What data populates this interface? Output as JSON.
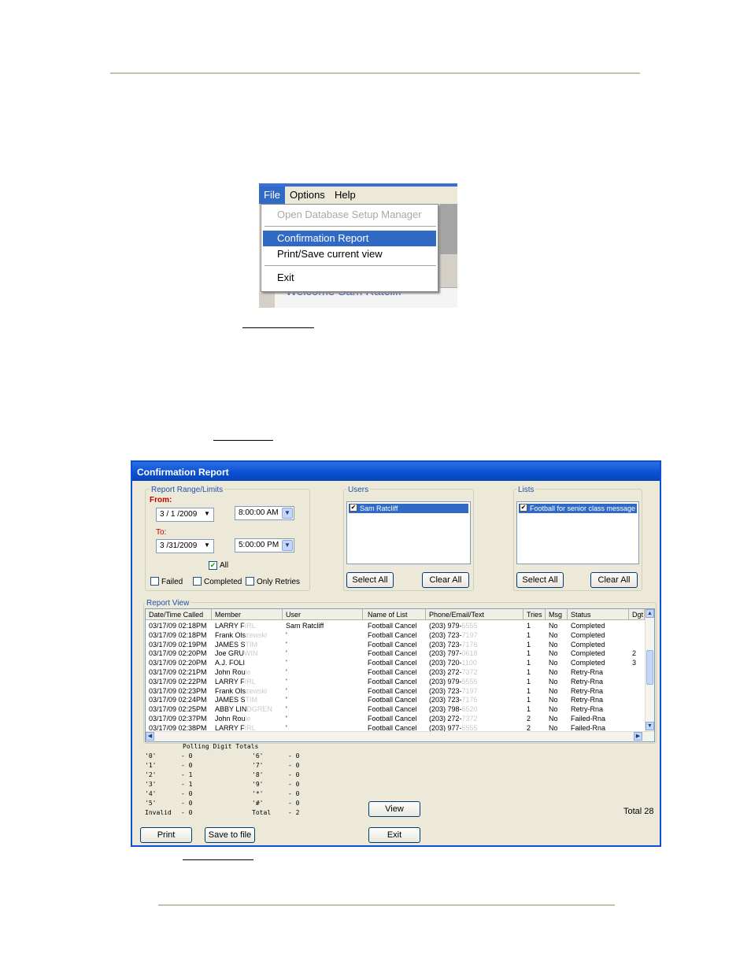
{
  "menu": {
    "bar": [
      "File",
      "Options",
      "Help"
    ],
    "items": {
      "open_db": "Open Database Setup Manager",
      "confirmation_report": "Confirmation Report",
      "print_save": "Print/Save current view",
      "exit": "Exit"
    },
    "welcome": "Welcome Sam Ratcliff"
  },
  "report": {
    "title": "Confirmation Report",
    "range_group": "Report Range/Limits",
    "from_label": "From:",
    "from_date": "3 / 1 /2009",
    "from_time": "8:00:00 AM",
    "to_label": "To:",
    "to_date": "3 /31/2009",
    "to_time": "5:00:00 PM",
    "all_label": "All",
    "failed_label": "Failed",
    "completed_label": "Completed",
    "only_retries_label": "Only Retries",
    "users_group": "Users",
    "user_item": "Sam Ratcliff",
    "lists_group": "Lists",
    "list_item": "Football for senior class message",
    "select_all": "Select All",
    "clear_all": "Clear All",
    "report_view_label": "Report View",
    "columns": [
      "Date/Time Called",
      "Member",
      "User",
      "Name of List",
      "Phone/Email/Text",
      "Tries",
      "Msg",
      "Status",
      "Dgt"
    ],
    "rows": [
      {
        "dt": "03/17/09 02:18PM",
        "m": "LARRY F",
        "mf": "IRL",
        "u": "Sam Ratcliff",
        "l": "Football Cancel",
        "p": "(203) 979-",
        "pf": "5555",
        "t": "1",
        "msg": "No",
        "s": "Completed",
        "d": ""
      },
      {
        "dt": "03/17/09 02:18PM",
        "m": "Frank Ols",
        "mf": "zewski",
        "u": "'",
        "l": "Football Cancel",
        "p": "(203) 723-",
        "pf": "7197",
        "t": "1",
        "msg": "No",
        "s": "Completed",
        "d": ""
      },
      {
        "dt": "03/17/09 02:19PM",
        "m": "JAMES S",
        "mf": "TIM",
        "u": "'",
        "l": "Football Cancel",
        "p": "(203) 723-",
        "pf": "7176",
        "t": "1",
        "msg": "No",
        "s": "Completed",
        "d": ""
      },
      {
        "dt": "03/17/09 02:20PM",
        "m": "Joe GRU",
        "mf": "WIN",
        "u": "'",
        "l": "Football Cancel",
        "p": "(203) 797-",
        "pf": "0618",
        "t": "1",
        "msg": "No",
        "s": "Completed",
        "d": "2"
      },
      {
        "dt": "03/17/09 02:20PM",
        "m": "A.J. FOLI",
        "mf": "",
        "u": "'",
        "l": "Football Cancel",
        "p": "(203) 720-",
        "pf": "1100",
        "t": "1",
        "msg": "No",
        "s": "Completed",
        "d": "3"
      },
      {
        "dt": "03/17/09 02:21PM",
        "m": "John Rou",
        "mf": "le",
        "u": "'",
        "l": "Football Cancel",
        "p": "(203) 272-",
        "pf": "7372",
        "t": "1",
        "msg": "No",
        "s": "Retry-Rna",
        "d": ""
      },
      {
        "dt": "03/17/09 02:22PM",
        "m": "LARRY F",
        "mf": "IRL",
        "u": "'",
        "l": "Football Cancel",
        "p": "(203) 979-",
        "pf": "5555",
        "t": "1",
        "msg": "No",
        "s": "Retry-Rna",
        "d": ""
      },
      {
        "dt": "03/17/09 02:23PM",
        "m": "Frank Ols",
        "mf": "zewski",
        "u": "'",
        "l": "Football Cancel",
        "p": "(203) 723-",
        "pf": "7197",
        "t": "1",
        "msg": "No",
        "s": "Retry-Rna",
        "d": ""
      },
      {
        "dt": "03/17/09 02:24PM",
        "m": "JAMES S",
        "mf": "TIM",
        "u": "'",
        "l": "Football Cancel",
        "p": "(203) 723-",
        "pf": "7176",
        "t": "1",
        "msg": "No",
        "s": "Retry-Rna",
        "d": ""
      },
      {
        "dt": "03/17/09 02:25PM",
        "m": "ABBY LIN",
        "mf": "DGREN",
        "u": "'",
        "l": "Football Cancel",
        "p": "(203) 798-",
        "pf": "6520",
        "t": "1",
        "msg": "No",
        "s": "Retry-Rna",
        "d": ""
      },
      {
        "dt": "03/17/09 02:37PM",
        "m": "John Rou",
        "mf": "le",
        "u": "'",
        "l": "Football Cancel",
        "p": "(203) 272-",
        "pf": "7372",
        "t": "2",
        "msg": "No",
        "s": "Failed-Rna",
        "d": ""
      },
      {
        "dt": "03/17/09 02:38PM",
        "m": "LARRY F",
        "mf": "IRL",
        "u": "'",
        "l": "Football Cancel",
        "p": "(203) 977-",
        "pf": "5555",
        "t": "2",
        "msg": "No",
        "s": "Failed-Rna",
        "d": ""
      }
    ],
    "polling_title": "Polling Digit Totals",
    "polling_left": [
      {
        "k": "'0'",
        "v": "- 0"
      },
      {
        "k": "'1'",
        "v": "- 0"
      },
      {
        "k": "'2'",
        "v": "- 1"
      },
      {
        "k": "'3'",
        "v": "- 1"
      },
      {
        "k": "'4'",
        "v": "- 0"
      },
      {
        "k": "'5'",
        "v": "- 0"
      },
      {
        "k": "Invalid",
        "v": "- 0"
      }
    ],
    "polling_right": [
      {
        "k": "'6'",
        "v": "- 0"
      },
      {
        "k": "'7'",
        "v": "- 0"
      },
      {
        "k": "'8'",
        "v": "- 0"
      },
      {
        "k": "'9'",
        "v": "- 0"
      },
      {
        "k": "'*'",
        "v": "- 0"
      },
      {
        "k": "'#'",
        "v": "- 0"
      },
      {
        "k": "Total",
        "v": "- 2"
      }
    ],
    "view_btn": "View",
    "total": "Total 28",
    "print_btn": "Print",
    "save_btn": "Save to file",
    "exit_btn": "Exit"
  }
}
